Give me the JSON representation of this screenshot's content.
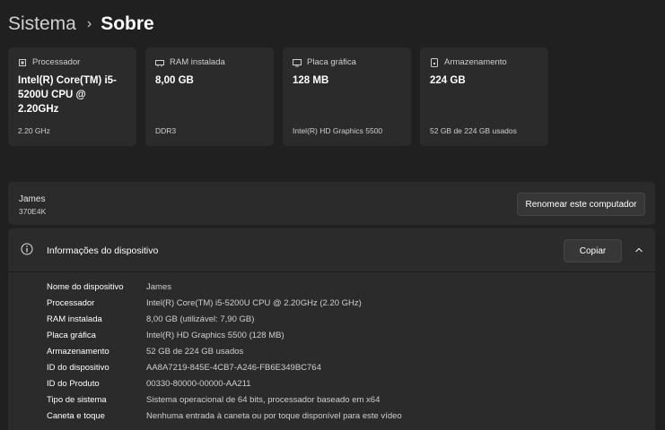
{
  "breadcrumb": {
    "parent": "Sistema",
    "separator": "›",
    "current": "Sobre"
  },
  "cards": [
    {
      "icon": "processor-icon",
      "label": "Processador",
      "value": "Intel(R) Core(TM) i5-5200U CPU @ 2.20GHz",
      "sub": "2.20 GHz"
    },
    {
      "icon": "ram-icon",
      "label": "RAM instalada",
      "value": "8,00 GB",
      "sub": "DDR3"
    },
    {
      "icon": "gpu-icon",
      "label": "Placa gráfica",
      "value": "128 MB",
      "sub": "Intel(R) HD Graphics 5500"
    },
    {
      "icon": "storage-icon",
      "label": "Armazenamento",
      "value": "224 GB",
      "sub": "52 GB de 224 GB usados"
    }
  ],
  "computer": {
    "name": "James",
    "model": "370E4K",
    "rename_label": "Renomear este computador"
  },
  "device_info": {
    "title": "Informações do dispositivo",
    "copy_label": "Copiar",
    "rows": [
      {
        "label": "Nome do dispositivo",
        "value": "James"
      },
      {
        "label": "Processador",
        "value": "Intel(R) Core(TM) i5-5200U CPU @ 2.20GHz (2.20 GHz)"
      },
      {
        "label": "RAM instalada",
        "value": "8,00 GB (utilizável: 7,90 GB)"
      },
      {
        "label": "Placa gráfica",
        "value": "Intel(R) HD Graphics 5500 (128 MB)"
      },
      {
        "label": "Armazenamento",
        "value": "52 GB de 224 GB usados"
      },
      {
        "label": "ID do dispositivo",
        "value": "AA8A7219-845E-4CB7-A246-FB6E349BC764"
      },
      {
        "label": "ID do Produto",
        "value": "00330-80000-00000-AA211"
      },
      {
        "label": "Tipo de sistema",
        "value": "Sistema operacional de 64 bits, processador baseado em x64"
      },
      {
        "label": "Caneta e toque",
        "value": "Nenhuma entrada à caneta ou por toque disponível para este vídeo"
      }
    ]
  },
  "colors": {
    "background": "#202020",
    "card": "#2b2b2b",
    "button": "#373737",
    "text_secondary": "#cfcfcf"
  }
}
